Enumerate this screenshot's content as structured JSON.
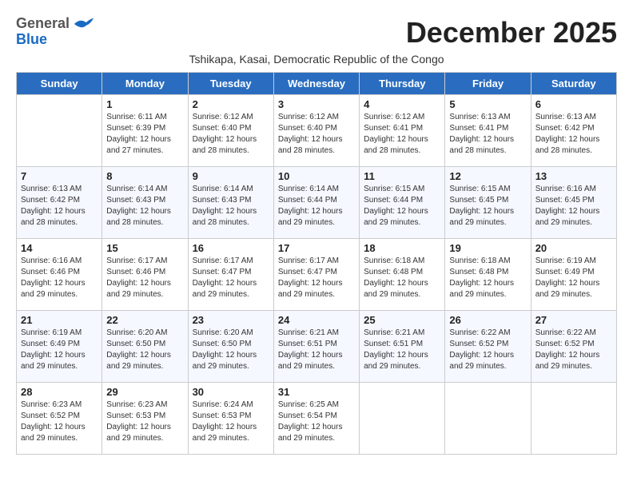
{
  "header": {
    "logo_general": "General",
    "logo_blue": "Blue",
    "month_title": "December 2025",
    "subtitle": "Tshikapa, Kasai, Democratic Republic of the Congo"
  },
  "days_of_week": [
    "Sunday",
    "Monday",
    "Tuesday",
    "Wednesday",
    "Thursday",
    "Friday",
    "Saturday"
  ],
  "weeks": [
    [
      {
        "day": "",
        "text": ""
      },
      {
        "day": "1",
        "text": "Sunrise: 6:11 AM\nSunset: 6:39 PM\nDaylight: 12 hours\nand 27 minutes."
      },
      {
        "day": "2",
        "text": "Sunrise: 6:12 AM\nSunset: 6:40 PM\nDaylight: 12 hours\nand 28 minutes."
      },
      {
        "day": "3",
        "text": "Sunrise: 6:12 AM\nSunset: 6:40 PM\nDaylight: 12 hours\nand 28 minutes."
      },
      {
        "day": "4",
        "text": "Sunrise: 6:12 AM\nSunset: 6:41 PM\nDaylight: 12 hours\nand 28 minutes."
      },
      {
        "day": "5",
        "text": "Sunrise: 6:13 AM\nSunset: 6:41 PM\nDaylight: 12 hours\nand 28 minutes."
      },
      {
        "day": "6",
        "text": "Sunrise: 6:13 AM\nSunset: 6:42 PM\nDaylight: 12 hours\nand 28 minutes."
      }
    ],
    [
      {
        "day": "7",
        "text": "Sunrise: 6:13 AM\nSunset: 6:42 PM\nDaylight: 12 hours\nand 28 minutes."
      },
      {
        "day": "8",
        "text": "Sunrise: 6:14 AM\nSunset: 6:43 PM\nDaylight: 12 hours\nand 28 minutes."
      },
      {
        "day": "9",
        "text": "Sunrise: 6:14 AM\nSunset: 6:43 PM\nDaylight: 12 hours\nand 28 minutes."
      },
      {
        "day": "10",
        "text": "Sunrise: 6:14 AM\nSunset: 6:44 PM\nDaylight: 12 hours\nand 29 minutes."
      },
      {
        "day": "11",
        "text": "Sunrise: 6:15 AM\nSunset: 6:44 PM\nDaylight: 12 hours\nand 29 minutes."
      },
      {
        "day": "12",
        "text": "Sunrise: 6:15 AM\nSunset: 6:45 PM\nDaylight: 12 hours\nand 29 minutes."
      },
      {
        "day": "13",
        "text": "Sunrise: 6:16 AM\nSunset: 6:45 PM\nDaylight: 12 hours\nand 29 minutes."
      }
    ],
    [
      {
        "day": "14",
        "text": "Sunrise: 6:16 AM\nSunset: 6:46 PM\nDaylight: 12 hours\nand 29 minutes."
      },
      {
        "day": "15",
        "text": "Sunrise: 6:17 AM\nSunset: 6:46 PM\nDaylight: 12 hours\nand 29 minutes."
      },
      {
        "day": "16",
        "text": "Sunrise: 6:17 AM\nSunset: 6:47 PM\nDaylight: 12 hours\nand 29 minutes."
      },
      {
        "day": "17",
        "text": "Sunrise: 6:17 AM\nSunset: 6:47 PM\nDaylight: 12 hours\nand 29 minutes."
      },
      {
        "day": "18",
        "text": "Sunrise: 6:18 AM\nSunset: 6:48 PM\nDaylight: 12 hours\nand 29 minutes."
      },
      {
        "day": "19",
        "text": "Sunrise: 6:18 AM\nSunset: 6:48 PM\nDaylight: 12 hours\nand 29 minutes."
      },
      {
        "day": "20",
        "text": "Sunrise: 6:19 AM\nSunset: 6:49 PM\nDaylight: 12 hours\nand 29 minutes."
      }
    ],
    [
      {
        "day": "21",
        "text": "Sunrise: 6:19 AM\nSunset: 6:49 PM\nDaylight: 12 hours\nand 29 minutes."
      },
      {
        "day": "22",
        "text": "Sunrise: 6:20 AM\nSunset: 6:50 PM\nDaylight: 12 hours\nand 29 minutes."
      },
      {
        "day": "23",
        "text": "Sunrise: 6:20 AM\nSunset: 6:50 PM\nDaylight: 12 hours\nand 29 minutes."
      },
      {
        "day": "24",
        "text": "Sunrise: 6:21 AM\nSunset: 6:51 PM\nDaylight: 12 hours\nand 29 minutes."
      },
      {
        "day": "25",
        "text": "Sunrise: 6:21 AM\nSunset: 6:51 PM\nDaylight: 12 hours\nand 29 minutes."
      },
      {
        "day": "26",
        "text": "Sunrise: 6:22 AM\nSunset: 6:52 PM\nDaylight: 12 hours\nand 29 minutes."
      },
      {
        "day": "27",
        "text": "Sunrise: 6:22 AM\nSunset: 6:52 PM\nDaylight: 12 hours\nand 29 minutes."
      }
    ],
    [
      {
        "day": "28",
        "text": "Sunrise: 6:23 AM\nSunset: 6:52 PM\nDaylight: 12 hours\nand 29 minutes."
      },
      {
        "day": "29",
        "text": "Sunrise: 6:23 AM\nSunset: 6:53 PM\nDaylight: 12 hours\nand 29 minutes."
      },
      {
        "day": "30",
        "text": "Sunrise: 6:24 AM\nSunset: 6:53 PM\nDaylight: 12 hours\nand 29 minutes."
      },
      {
        "day": "31",
        "text": "Sunrise: 6:25 AM\nSunset: 6:54 PM\nDaylight: 12 hours\nand 29 minutes."
      },
      {
        "day": "",
        "text": ""
      },
      {
        "day": "",
        "text": ""
      },
      {
        "day": "",
        "text": ""
      }
    ]
  ]
}
